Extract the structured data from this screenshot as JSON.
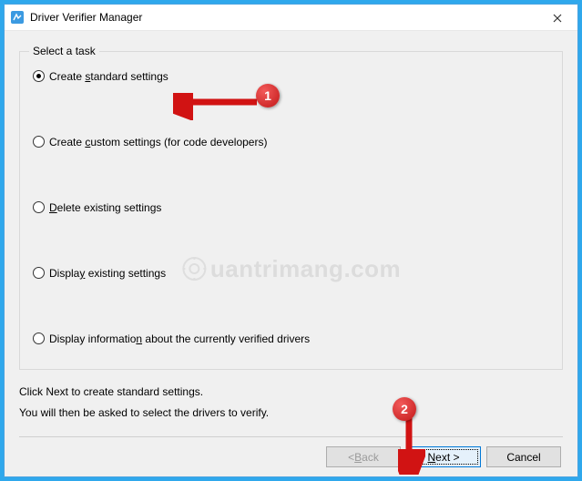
{
  "window": {
    "title": "Driver Verifier Manager"
  },
  "group": {
    "title": "Select a task"
  },
  "options": {
    "o1_pre": "Create ",
    "o1_ul": "s",
    "o1_post": "tandard settings",
    "o2_pre": "Create ",
    "o2_ul": "c",
    "o2_post": "ustom settings (for code developers)",
    "o3_ul": "D",
    "o3_post": "elete existing settings",
    "o4_pre": "Displa",
    "o4_ul": "y",
    "o4_post": " existing settings",
    "o5_pre": "Display informatio",
    "o5_ul": "n",
    "o5_post": " about the currently verified drivers"
  },
  "info": {
    "line1": "Click Next to create standard settings.",
    "line2": "You will then be asked to select the drivers to verify."
  },
  "buttons": {
    "back_pre": "< ",
    "back_ul": "B",
    "back_post": "ack",
    "next_pre": "",
    "next_ul": "N",
    "next_post": "ext >",
    "cancel": "Cancel"
  },
  "annotations": {
    "badge1": "1",
    "badge2": "2"
  },
  "watermark": {
    "text": "uantrimang.com"
  }
}
